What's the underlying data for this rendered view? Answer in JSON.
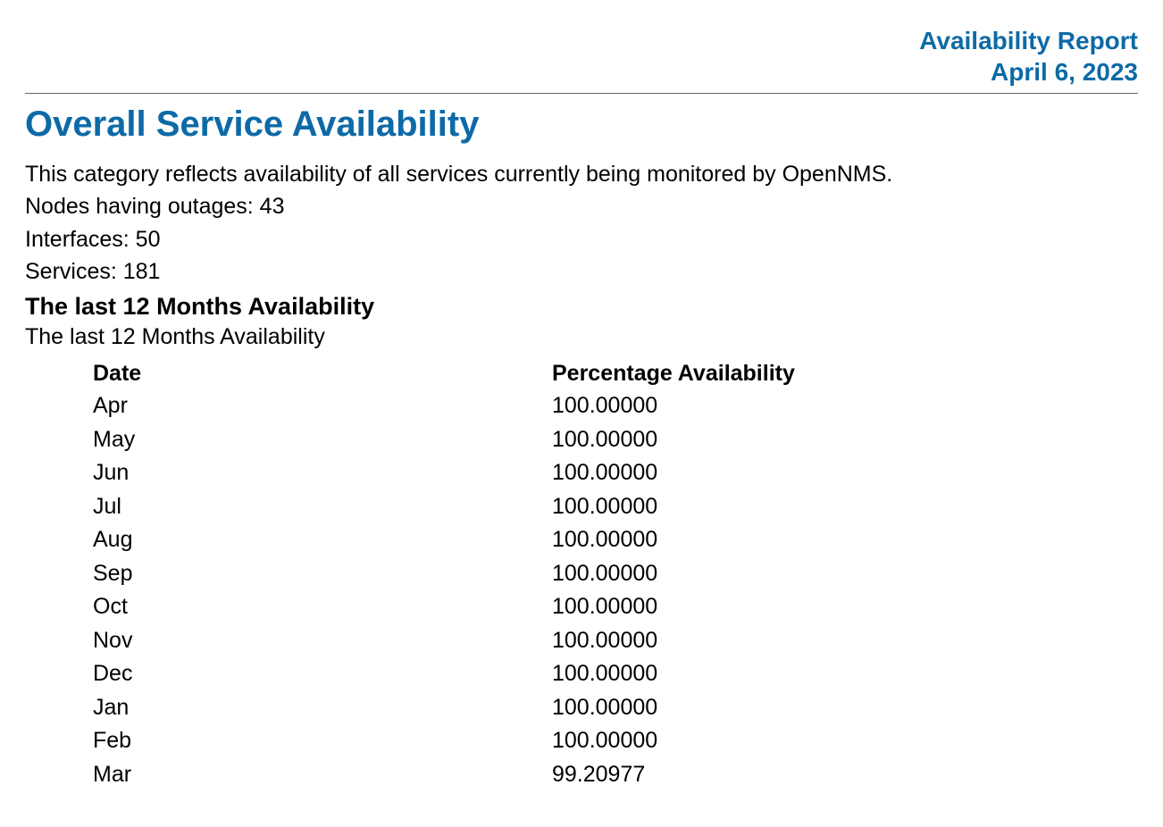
{
  "header": {
    "title": "Availability Report",
    "date": "April 6, 2023"
  },
  "section": {
    "title": "Overall Service Availability",
    "description": "This category reflects availability of all services currently being monitored by OpenNMS.",
    "nodes_outages_label": "Nodes having outages: 43",
    "interfaces_label": "Interfaces: 50",
    "services_label": "Services: 181"
  },
  "subsection": {
    "heading": "The last 12 Months Availability",
    "description": "The last 12 Months Availability"
  },
  "table": {
    "headers": {
      "date": "Date",
      "percentage": "Percentage Availability"
    },
    "rows": [
      {
        "date": "Apr",
        "pct": "100.00000"
      },
      {
        "date": "May",
        "pct": "100.00000"
      },
      {
        "date": "Jun",
        "pct": "100.00000"
      },
      {
        "date": "Jul",
        "pct": "100.00000"
      },
      {
        "date": "Aug",
        "pct": "100.00000"
      },
      {
        "date": "Sep",
        "pct": "100.00000"
      },
      {
        "date": "Oct",
        "pct": "100.00000"
      },
      {
        "date": "Nov",
        "pct": "100.00000"
      },
      {
        "date": "Dec",
        "pct": "100.00000"
      },
      {
        "date": "Jan",
        "pct": "100.00000"
      },
      {
        "date": "Feb",
        "pct": "100.00000"
      },
      {
        "date": "Mar",
        "pct": "99.20977"
      }
    ]
  }
}
